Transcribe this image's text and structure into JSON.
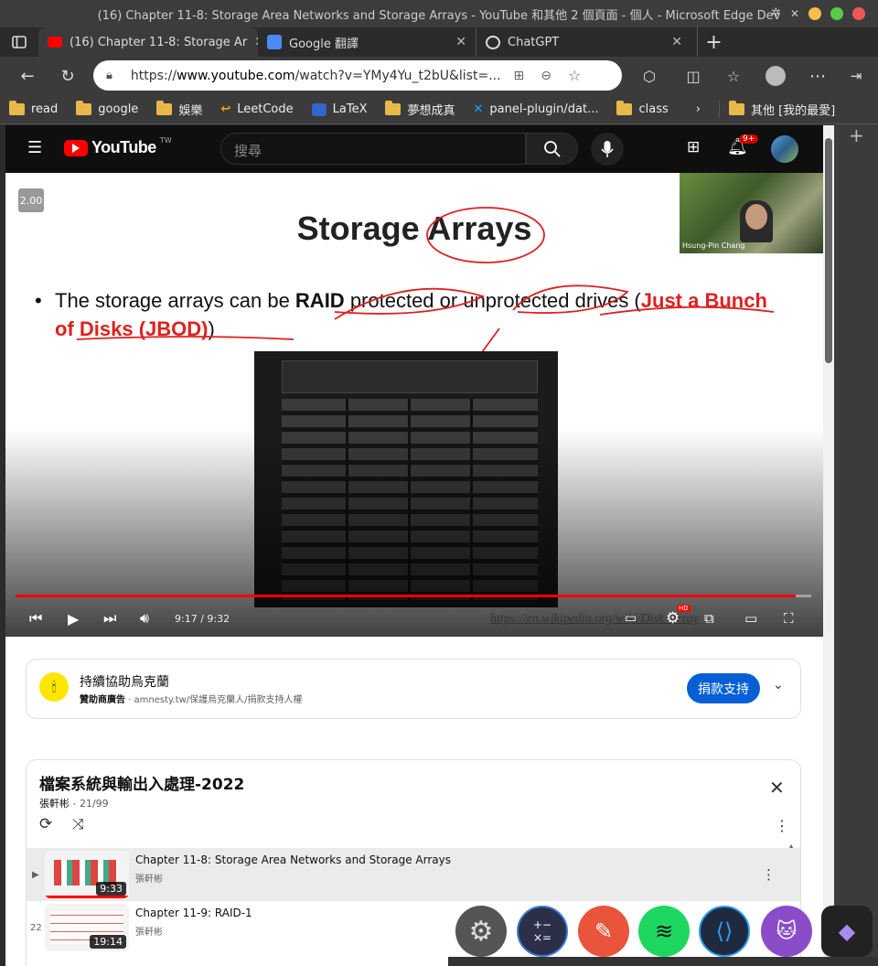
{
  "window": {
    "title": "(16) Chapter 11-8: Storage Area Networks and Storage Arrays - YouTube 和其他 2 個頁面 - 個人 - Microsoft Edge Dev"
  },
  "tabs": [
    {
      "label": "(16) Chapter 11-8: Storage Ar",
      "active": true
    },
    {
      "label": "Google 翻譯",
      "active": false
    },
    {
      "label": "ChatGPT",
      "active": false
    }
  ],
  "address_bar": {
    "url_prefix": "https://",
    "url_host": "www.youtube.com",
    "url_rest": "/watch?v=YMy4Yu_t2bU&list=..."
  },
  "bookmarks": [
    "read",
    "google",
    "娛樂",
    "LeetCode",
    "LaTeX",
    "夢想成真",
    "panel-plugin/dat...",
    "class",
    "其他 [我的最愛]"
  ],
  "youtube": {
    "logo_text": "YouTube",
    "region": "TW",
    "search_placeholder": "搜尋",
    "notification_count": "9+"
  },
  "player": {
    "speed_badge": "2.00",
    "cam_name": "Hsung-Pin Chang",
    "slide_title": "Storage Arrays",
    "bullet_pre": "The storage arrays can be ",
    "bullet_raid": "RAID",
    "bullet_mid": " protected or unprotected drives (",
    "bullet_red": "Just a Bunch of Disks (JBOD)",
    "bullet_end": ")",
    "wiki_link": "https://en.wikipedia.org/wiki/Disk_array",
    "time": "9:17 / 9:32",
    "progress": 0.98,
    "hd_badge": "HD"
  },
  "ad": {
    "title": "持續協助烏克蘭",
    "sponsor": "贊助商廣告",
    "link": "amnesty.tw/保護烏克蘭人/捐款支持人權",
    "button": "捐款支持"
  },
  "playlist": {
    "title": "檔案系統與輸出入處理-2022",
    "owner": "張軒彬",
    "position": "21/99",
    "items": [
      {
        "index": "▶",
        "title": "Chapter 11-8: Storage Area Networks and Storage Arrays",
        "channel": "張軒彬",
        "duration": "9:33",
        "current": true
      },
      {
        "index": "22",
        "title": "Chapter 11-9: RAID-1",
        "channel": "張軒彬",
        "duration": "19:14",
        "current": false
      }
    ]
  },
  "dock_apps": [
    "settings-icon",
    "calculator-icon",
    "pencil-icon",
    "spotify-icon",
    "vscode-icon",
    "github-icon",
    "obsidian-icon"
  ]
}
